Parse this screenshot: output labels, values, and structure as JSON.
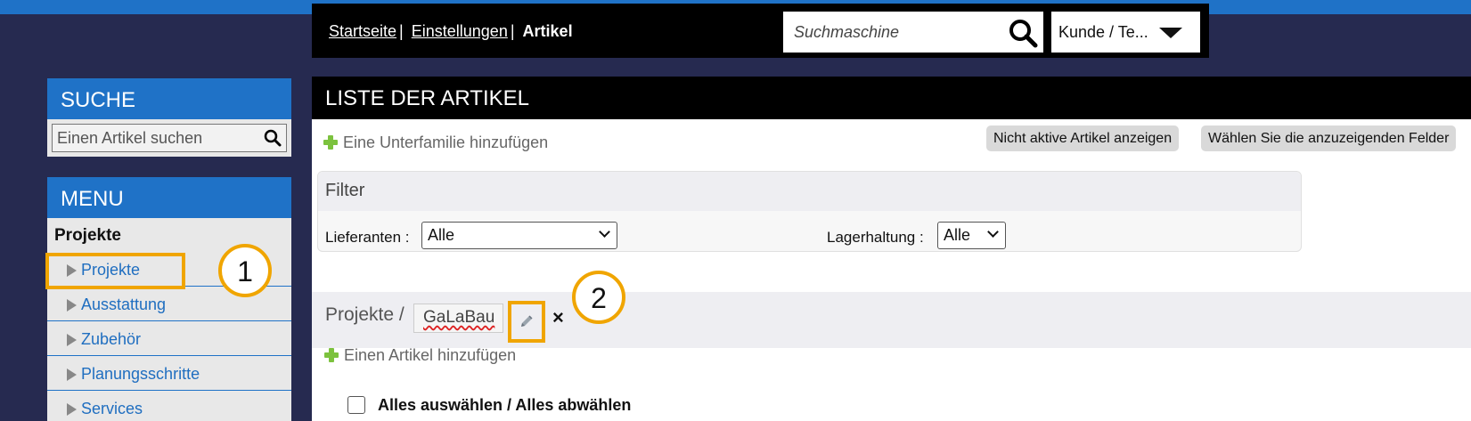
{
  "topbar": {
    "breadcrumb": [
      {
        "label": "Startseite"
      },
      {
        "label": "Einstellungen"
      },
      {
        "label": "Artikel"
      }
    ],
    "separator": "|",
    "search_placeholder": "Suchmaschine",
    "customer_select": "Kunde / Te..."
  },
  "sidebar": {
    "search_title": "SUCHE",
    "search_placeholder": "Einen Artikel suchen",
    "menu_title": "MENU",
    "menu_group": "Projekte",
    "items": [
      {
        "label": "Projekte"
      },
      {
        "label": "Ausstattung"
      },
      {
        "label": "Zubehör"
      },
      {
        "label": "Planungsschritte"
      },
      {
        "label": "Services"
      }
    ]
  },
  "main": {
    "title": "LISTE DER ARTIKEL",
    "add_subfamily": "Eine Unterfamilie hinzufügen",
    "btn_inactive": "Nicht aktive Artikel anzeigen",
    "btn_fields": "Wählen Sie die anzuzeigenden Felder",
    "filter": {
      "title": "Filter",
      "supplier_label": "Lieferanten :",
      "supplier_value": "Alle",
      "stock_label": "Lagerhaltung :",
      "stock_value": "Alle"
    },
    "category_path": "Projekte /",
    "category_name": "GaLaBau",
    "close_symbol": "×",
    "add_article": "Einen Artikel hinzufügen",
    "select_all": "Alles auswählen / Alles abwählen"
  },
  "callouts": {
    "one": "1",
    "two": "2"
  },
  "colors": {
    "background": "#262a50",
    "accent_blue": "#1f72c7",
    "highlight": "#f0a500",
    "plus_green": "#7cc23e"
  }
}
